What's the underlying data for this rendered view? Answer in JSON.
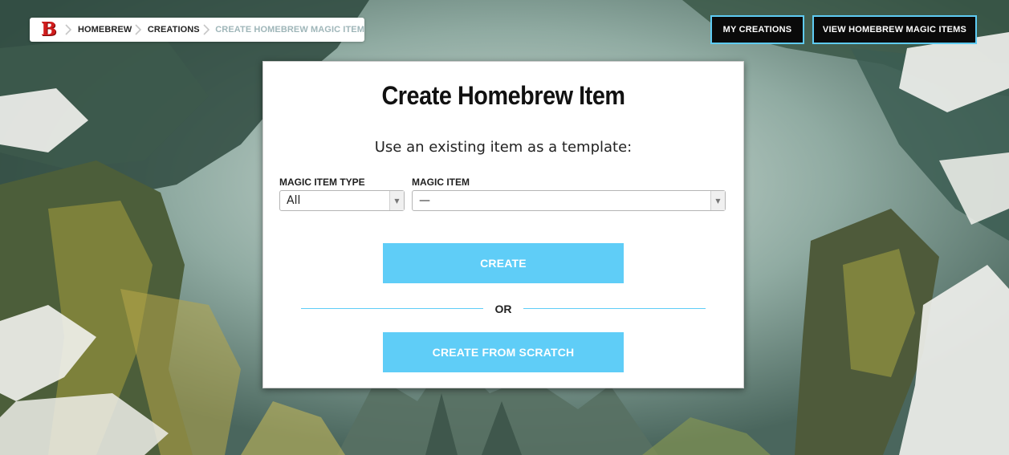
{
  "breadcrumb": {
    "logo": "B",
    "items": [
      "HOMEBREW",
      "CREATIONS",
      "CREATE HOMEBREW MAGIC ITEM"
    ]
  },
  "header": {
    "my_creations": "MY CREATIONS",
    "view_items": "VIEW HOMEBREW MAGIC ITEMS"
  },
  "modal": {
    "title": "Create Homebrew Item",
    "subtitle": "Use an existing item as a template:",
    "type_label": "MAGIC ITEM TYPE",
    "type_value": "All",
    "item_label": "MAGIC ITEM",
    "item_value": "—",
    "create_button": "CREATE",
    "or_text": "OR",
    "scratch_button": "CREATE FROM SCRATCH"
  },
  "colors": {
    "accent": "#5fcdf7",
    "logo_red": "#d11c1c",
    "header_button_bg": "#0a0a0a"
  }
}
